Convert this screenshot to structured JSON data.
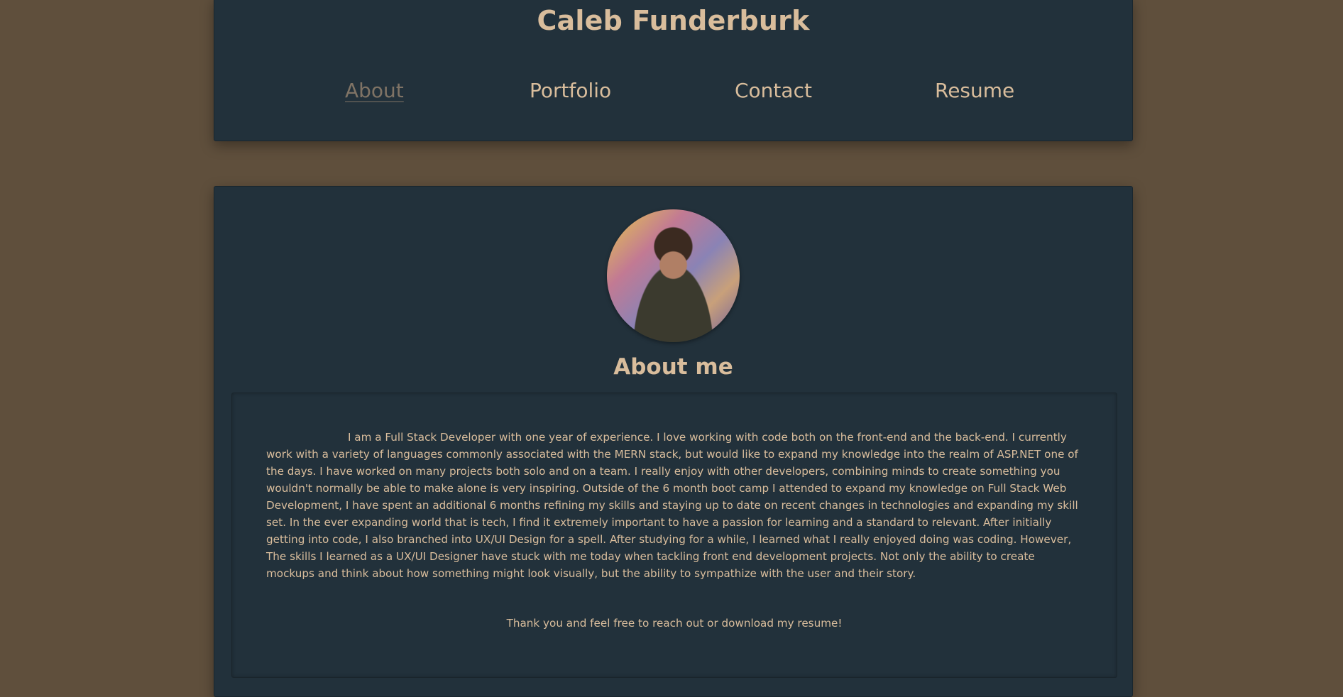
{
  "header": {
    "site_title": "Caleb Funderburk",
    "nav": {
      "about": "About",
      "portfolio": "Portfolio",
      "contact": "Contact",
      "resume": "Resume"
    },
    "active_nav": "about"
  },
  "about": {
    "heading": "About me",
    "bio": "I am a Full Stack Developer with one year of experience. I love working with code both on the front-end and the back-end. I currently work with a variety of languages commonly associated with the MERN stack, but would like to expand my knowledge into the realm of ASP.NET one of the days. I have worked on many projects both solo and on a team. I really enjoy with other developers, combining minds to create something you wouldn't normally be able to make alone is very inspiring. Outside of the 6 month boot camp I attended to expand my knowledge on Full Stack Web Development, I have spent an additional 6 months refining my skills and staying up to date on recent changes in technologies and expanding my skill set. In the ever expanding world that is tech, I find it extremely important to have a passion for learning and a standard to relevant. After initially getting into code, I also branched into UX/UI Design for a spell. After studying for a while, I learned what I really enjoyed doing was coding. However, The skills I learned as a UX/UI Designer have stuck with me today when tackling front end development projects. Not only the ability to create mockups and think about how something might look visually, but the ability to sympathize with the user and their story.",
    "closing": "Thank you and feel free to reach out or download my resume!"
  },
  "colors": {
    "page_background": "#5f4f3c",
    "card_background": "#22313b",
    "text": "#d9bd9c",
    "active_nav": "#7f7365"
  }
}
